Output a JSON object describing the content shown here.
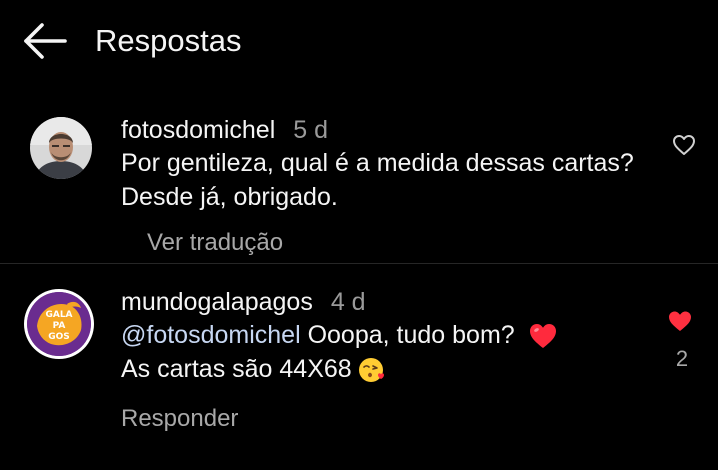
{
  "header": {
    "title": "Respostas",
    "back_icon": "arrow-left-icon"
  },
  "comments": [
    {
      "username": "fotosdomichel",
      "time": "5 d",
      "text": "Por gentileza,  qual é a medida dessas cartas? Desde já, obrigado.",
      "action": "Ver tradução",
      "liked": false,
      "like_icon": "heart-outline-icon"
    },
    {
      "username": "mundogalapagos",
      "time": "4 d",
      "mention": "@fotosdomichel",
      "text_line1": " Ooopa, tudo bom? ",
      "text_line2": "As cartas são 44X68",
      "action": "Responder",
      "liked": true,
      "like_count": "2",
      "like_icon": "heart-filled-icon",
      "avatar_logo": {
        "line1": "GALA",
        "line2": "PA",
        "line3": "GOS"
      }
    }
  ],
  "colors": {
    "background": "#000000",
    "text": "#f5f5f5",
    "muted": "#a8a8a8",
    "mention": "#c7d7f2",
    "like_red": "#ff3040"
  }
}
